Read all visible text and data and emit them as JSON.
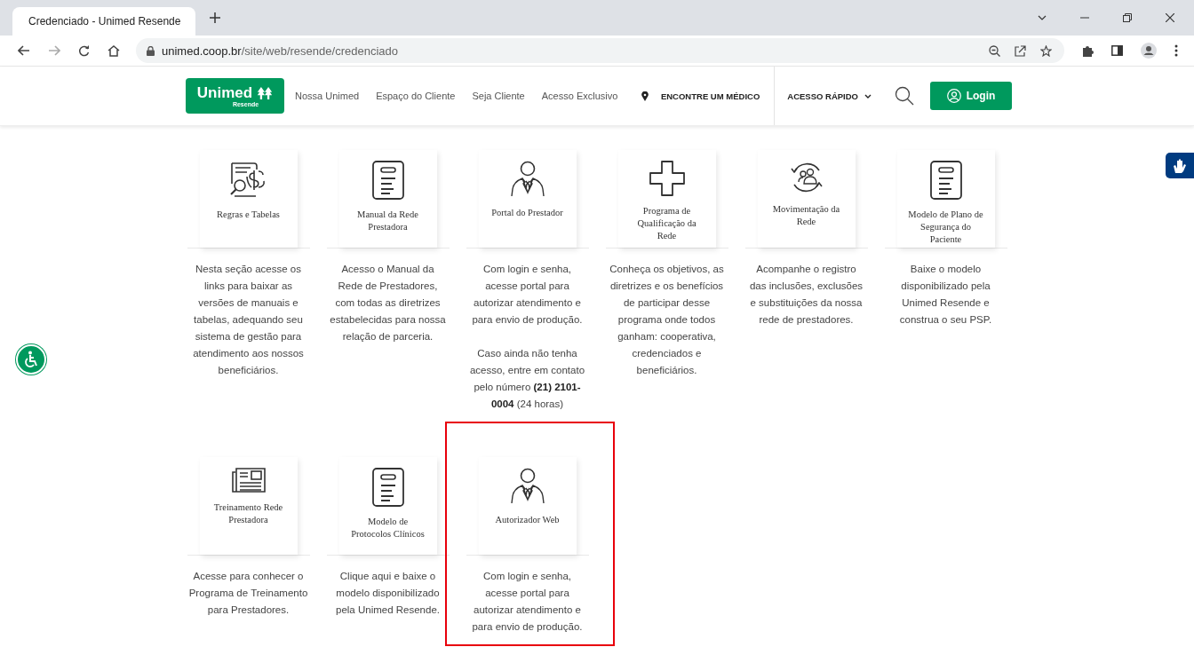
{
  "browser": {
    "tab_title": "Credenciado - Unimed Resende",
    "url_host": "unimed.coop.br",
    "url_path": "/site/web/resende/credenciado"
  },
  "header": {
    "logo": "Unimed",
    "logo_sub": "Resende",
    "nav": [
      "Nossa Unimed",
      "Espaço do Cliente",
      "Seja Cliente",
      "Acesso Exclusivo"
    ],
    "find_doctor": "ENCONTRE UM MÉDICO",
    "quick_access": "ACESSO RÁPIDO",
    "login": "Login"
  },
  "rows": [
    [
      {
        "kind": "money-doc",
        "title": "Regras e Tabelas",
        "paragraphs": [
          "Nesta seção acesse os links para baixar as versões de manuais e tabelas, adequando seu sistema de gestão para atendimento aos nossos beneficiários."
        ],
        "highlighted": false
      },
      {
        "kind": "document",
        "title": "Manual da Rede Prestadora",
        "paragraphs": [
          "Acesso o Manual da Rede de Prestadores, com todas as diretrizes estabelecidas para nossa relação de parceria."
        ],
        "highlighted": false
      },
      {
        "kind": "person",
        "title": "Portal do Prestador",
        "paragraphs": [
          "Com login e senha, acesse portal para autorizar atendimento e para envio de produção.",
          "Caso ainda não tenha acesso, entre em contato pelo número **(21) 2101-0004** (24 horas)"
        ],
        "highlighted": false
      },
      {
        "kind": "cross",
        "title": "Programa de Qualificação da Rede",
        "paragraphs": [
          "Conheça os objetivos, as diretrizes e os benefícios de participar desse programa onde todos ganham: cooperativa, credenciados e beneficiários."
        ],
        "highlighted": false
      },
      {
        "kind": "people-cycle",
        "title": "Movimentação da Rede",
        "paragraphs": [
          "Acompanhe o registro das inclusões, exclusões e substituições da nossa rede de prestadores."
        ],
        "highlighted": false
      },
      {
        "kind": "document",
        "title": "Modelo de Plano de Segurança do Paciente",
        "paragraphs": [
          "Baixe o modelo disponibilizado pela Unimed Resende e construa o seu PSP."
        ],
        "highlighted": false
      }
    ],
    [
      {
        "kind": "newspaper",
        "title": "Treinamento Rede Prestadora",
        "paragraphs": [
          "Acesse para conhecer o Programa de Treinamento para Prestadores."
        ],
        "highlighted": false
      },
      {
        "kind": "document",
        "title": "Modelo de Protocolos Clínicos",
        "paragraphs": [
          "Clique aqui e baixe o modelo disponibilizado pela Unimed Resende."
        ],
        "highlighted": false
      },
      {
        "kind": "person",
        "title": "Autorizador Web",
        "paragraphs": [
          "Com login e senha, acesse portal para autorizar atendimento e para envio de produção."
        ],
        "highlighted": true
      }
    ]
  ]
}
